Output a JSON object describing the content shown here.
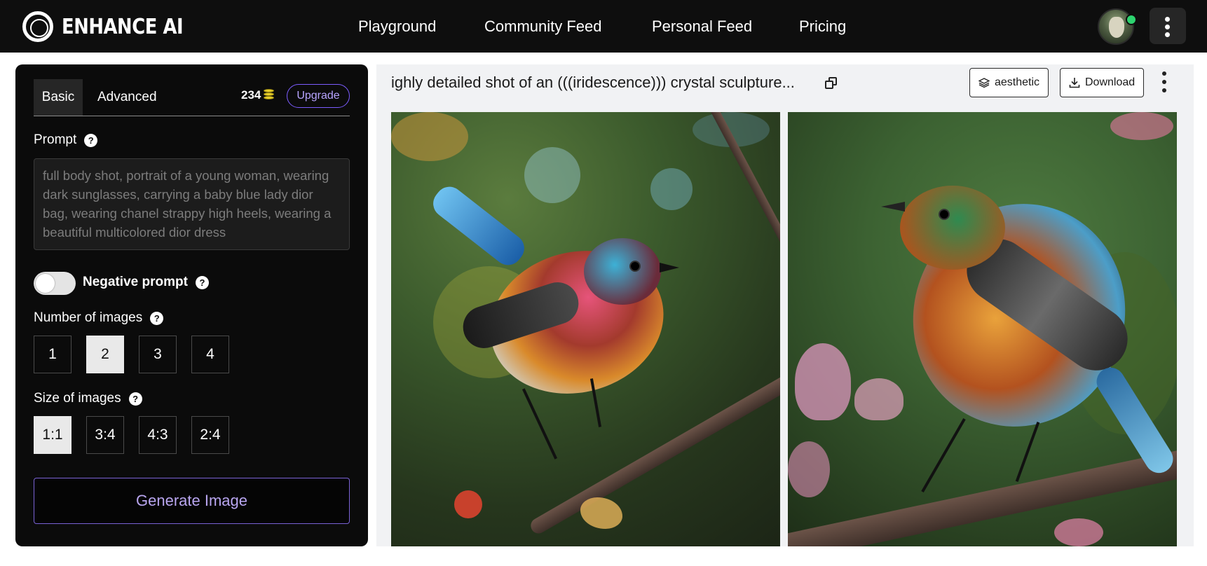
{
  "header": {
    "brand": "ENHANCE AI",
    "nav": [
      "Playground",
      "Community Feed",
      "Personal Feed",
      "Pricing"
    ],
    "avatar_status": "online",
    "icons": {
      "logo": "ring-logo-icon",
      "menu": "kebab-menu-icon"
    }
  },
  "panel": {
    "tabs": {
      "basic": "Basic",
      "advanced": "Advanced"
    },
    "credits": "234",
    "upgrade_label": "Upgrade",
    "prompt_label": "Prompt",
    "prompt_placeholder": "full body shot, portrait of a young woman, wearing dark sunglasses, carrying a baby blue lady dior bag, wearing chanel strappy high heels, wearing a beautiful multicolored dior dress",
    "negative_prompt_label": "Negative prompt",
    "negative_prompt_enabled": false,
    "num_images_label": "Number of images",
    "num_images_options": [
      "1",
      "2",
      "3",
      "4"
    ],
    "num_images_selected": "2",
    "size_label": "Size of images",
    "size_options": [
      "1:1",
      "3:4",
      "4:3",
      "2:4"
    ],
    "size_selected": "1:1",
    "generate_label": "Generate Image",
    "help_glyph": "?"
  },
  "result": {
    "title": "ighly detailed shot of an (((iridescence))) crystal sculpture...",
    "style_label": "aesthetic",
    "download_label": "Download",
    "images": [
      "crystal-bird-image-1",
      "crystal-bird-image-2"
    ]
  },
  "colors": {
    "header_bg": "#0e0e0e",
    "accent_purple": "#7c5cff",
    "online_green": "#2dd36f",
    "coin_yellow": "#e8cf2a"
  }
}
